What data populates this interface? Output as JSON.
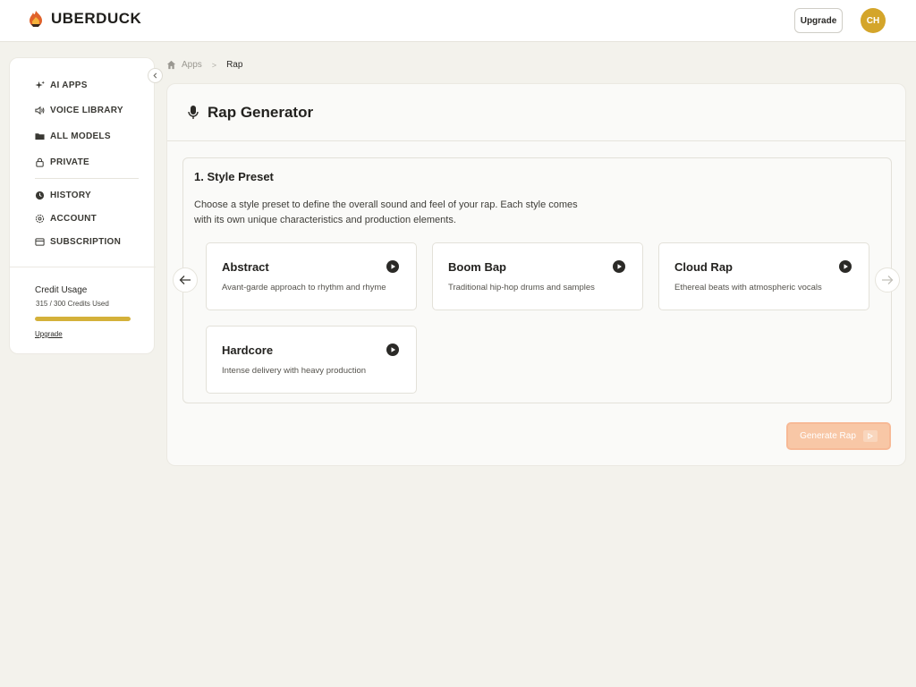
{
  "app": {
    "name": "UBERDUCK"
  },
  "header": {
    "upgrade_label": "Upgrade",
    "avatar_initials": "CH",
    "avatar_color": "#d4a52a"
  },
  "sidebar": {
    "items": [
      {
        "label": "AI APPS",
        "icon": "sparkle-icon"
      },
      {
        "label": "VOICE LIBRARY",
        "icon": "speaker-icon"
      },
      {
        "label": "ALL MODELS",
        "icon": "folder-icon"
      },
      {
        "label": "PRIVATE",
        "icon": "lock-icon"
      },
      {
        "label": "HISTORY",
        "icon": "clock-icon"
      },
      {
        "label": "ACCOUNT",
        "icon": "gear-icon"
      },
      {
        "label": "SUBSCRIPTION",
        "icon": "card-icon"
      }
    ],
    "credit": {
      "title": "Credit Usage",
      "used_text": "315 / 300 Credits Used",
      "progress": 1.0,
      "bar_color": "#d4b13a",
      "upgrade_link": "Upgrade"
    }
  },
  "breadcrumb": {
    "root": "Apps",
    "separator": ">",
    "current": "Rap"
  },
  "main": {
    "title": "Rap Generator",
    "section": {
      "title": "1. Style Preset",
      "description": "Choose a style preset to define the overall sound and feel of your rap. Each style comes with its own unique characteristics and production elements."
    },
    "presets": [
      {
        "name": "Abstract",
        "description": "Avant-garde approach to rhythm and rhyme"
      },
      {
        "name": "Boom Bap",
        "description": "Traditional hip-hop drums and samples"
      },
      {
        "name": "Cloud Rap",
        "description": "Ethereal beats with atmospheric vocals"
      },
      {
        "name": "Hardcore",
        "description": "Intense delivery with heavy production"
      }
    ],
    "generate_label": "Generate Rap",
    "accent_color": "#f8c7a6"
  }
}
